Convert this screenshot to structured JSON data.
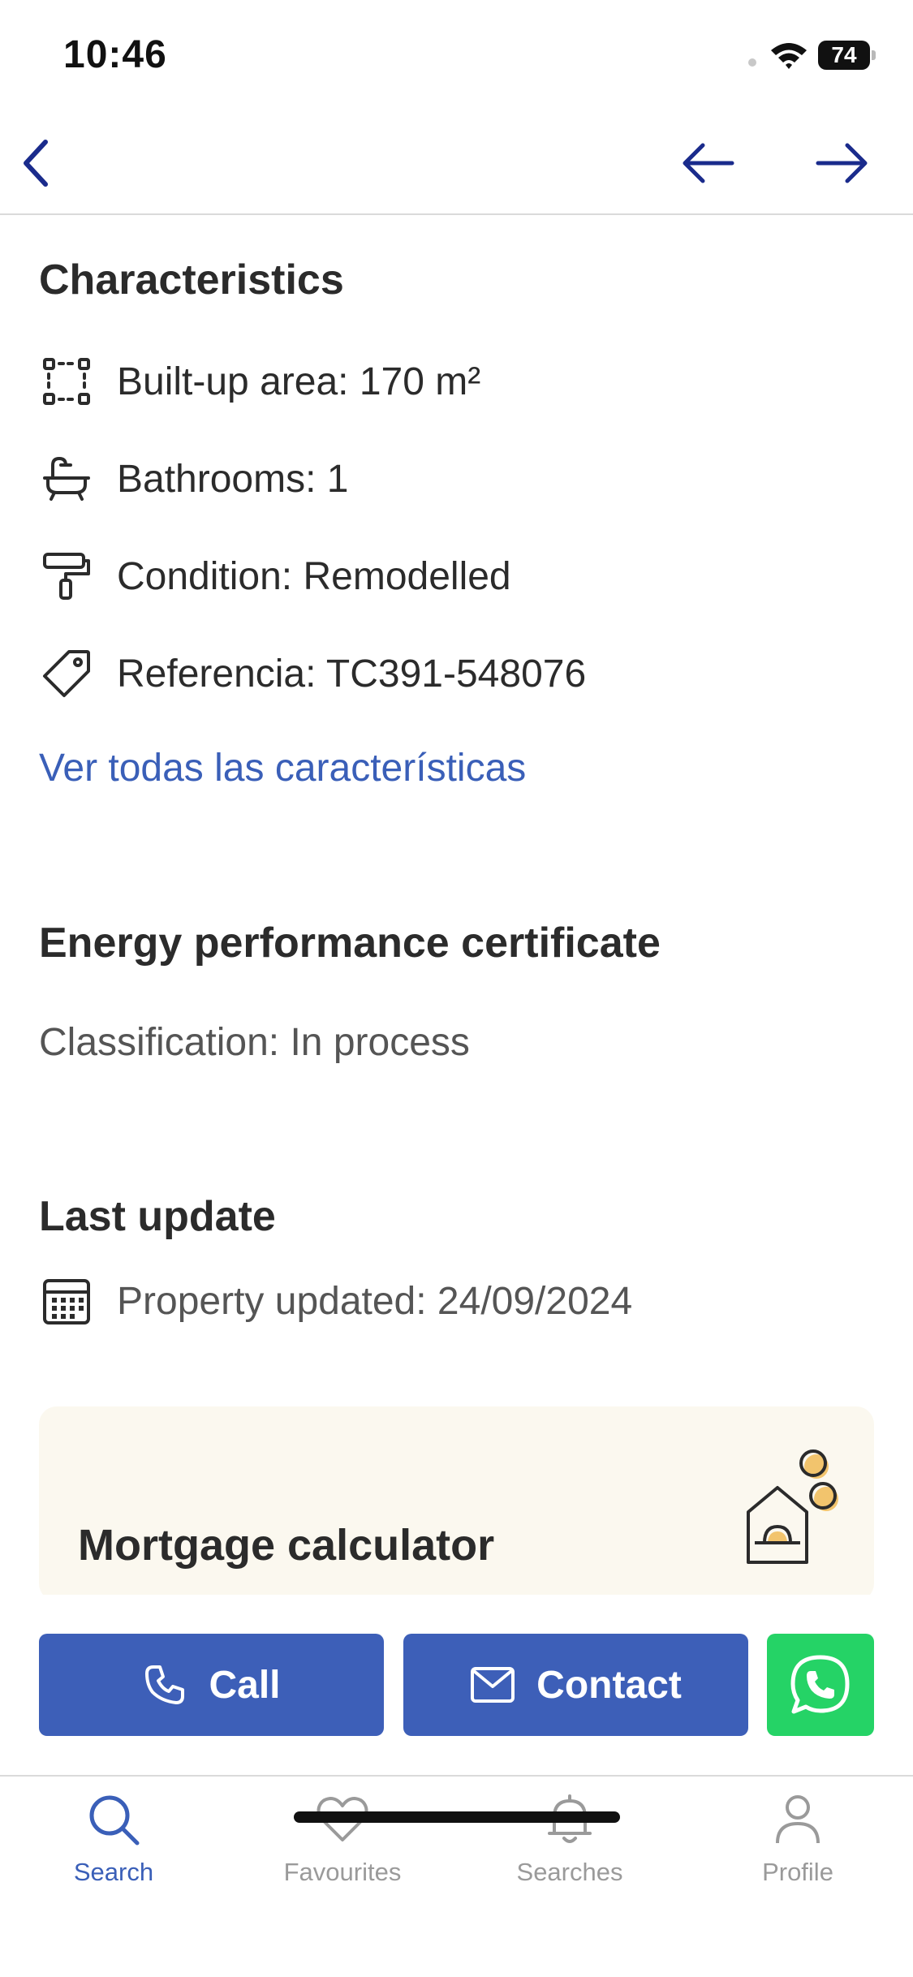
{
  "status_bar": {
    "time": "10:46",
    "battery": "74"
  },
  "nav": {
    "back_icon": "chevron-left-icon",
    "prev_icon": "arrow-left-icon",
    "next_icon": "arrow-right-icon",
    "accent": "#1a2b8c"
  },
  "characteristics": {
    "title": "Characteristics",
    "items": [
      {
        "icon": "area-icon",
        "text": "Built-up area: 170 m²"
      },
      {
        "icon": "bathtub-icon",
        "text": "Bathrooms: 1"
      },
      {
        "icon": "paint-roller-icon",
        "text": "Condition: Remodelled"
      },
      {
        "icon": "tag-icon",
        "text": "Referencia: TC391-548076"
      }
    ],
    "see_all_link": "Ver todas las características"
  },
  "energy": {
    "title": "Energy performance certificate",
    "classification": "Classification: In process"
  },
  "last_update": {
    "title": "Last update",
    "icon": "calendar-icon",
    "text": "Property updated: 24/09/2024"
  },
  "mortgage": {
    "title": "Mortgage calculator",
    "icon": "house-coins-icon"
  },
  "actions": {
    "call_label": "Call",
    "contact_label": "Contact",
    "whatsapp_icon": "whatsapp-icon",
    "primary_color": "#3d5fb8",
    "whatsapp_color": "#25d366"
  },
  "tabs": [
    {
      "label": "Search",
      "icon": "search-icon",
      "active": true
    },
    {
      "label": "Favourites",
      "icon": "heart-icon",
      "active": false
    },
    {
      "label": "Searches",
      "icon": "bell-icon",
      "active": false
    },
    {
      "label": "Profile",
      "icon": "person-icon",
      "active": false
    }
  ]
}
